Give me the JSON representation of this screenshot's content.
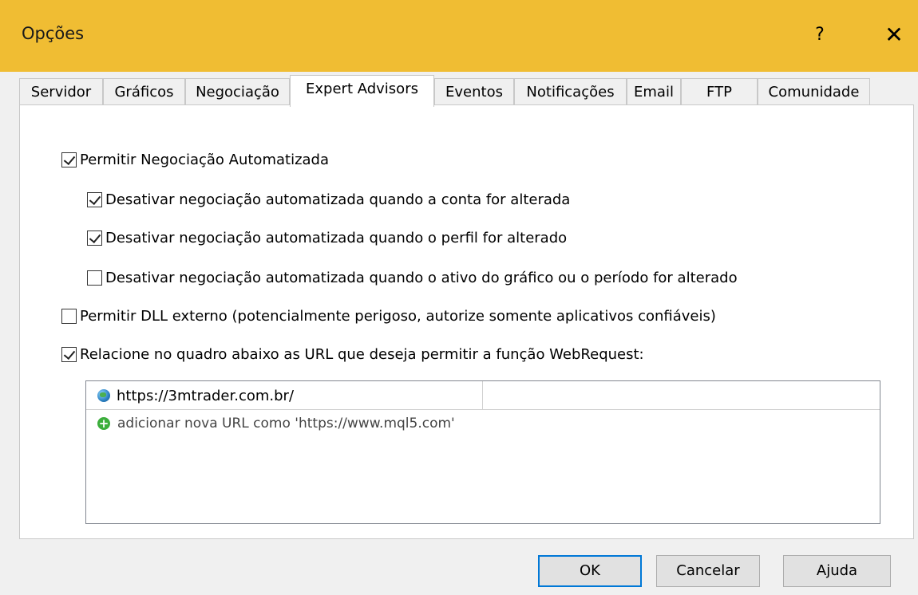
{
  "window": {
    "title": "Opções",
    "help": "?",
    "close": "✕"
  },
  "tabs": [
    {
      "label": "Servidor",
      "active": false
    },
    {
      "label": "Gráficos",
      "active": false
    },
    {
      "label": "Negociação",
      "active": false
    },
    {
      "label": "Expert Advisors",
      "active": true
    },
    {
      "label": "Eventos",
      "active": false
    },
    {
      "label": "Notificações",
      "active": false
    },
    {
      "label": "Email",
      "active": false
    },
    {
      "label": "FTP",
      "active": false
    },
    {
      "label": "Comunidade",
      "active": false
    }
  ],
  "options": [
    {
      "label": "Permitir Negociação Automatizada",
      "checked": true
    },
    {
      "label": "Desativar negociação automatizada quando a conta for alterada",
      "checked": true
    },
    {
      "label": "Desativar negociação automatizada quando o perfil for alterado",
      "checked": true
    },
    {
      "label": "Desativar negociação automatizada quando o ativo do gráfico ou o período for alterado",
      "checked": false
    },
    {
      "label": "Permitir DLL externo (potencialmente perigoso, autorize somente aplicativos confiáveis)",
      "checked": false
    },
    {
      "label": "Relacione no quadro abaixo as URL que deseja permitir a função WebRequest:",
      "checked": true
    }
  ],
  "url_list": {
    "items": [
      "https://3mtrader.com.br/"
    ],
    "add_hint": "adicionar nova URL como 'https://www.mql5.com'"
  },
  "buttons": {
    "ok": "OK",
    "cancel": "Cancelar",
    "help": "Ajuda"
  },
  "icons": {
    "url_item": "globe-icon",
    "add": "plus-circle-icon",
    "check": "checkmark"
  }
}
